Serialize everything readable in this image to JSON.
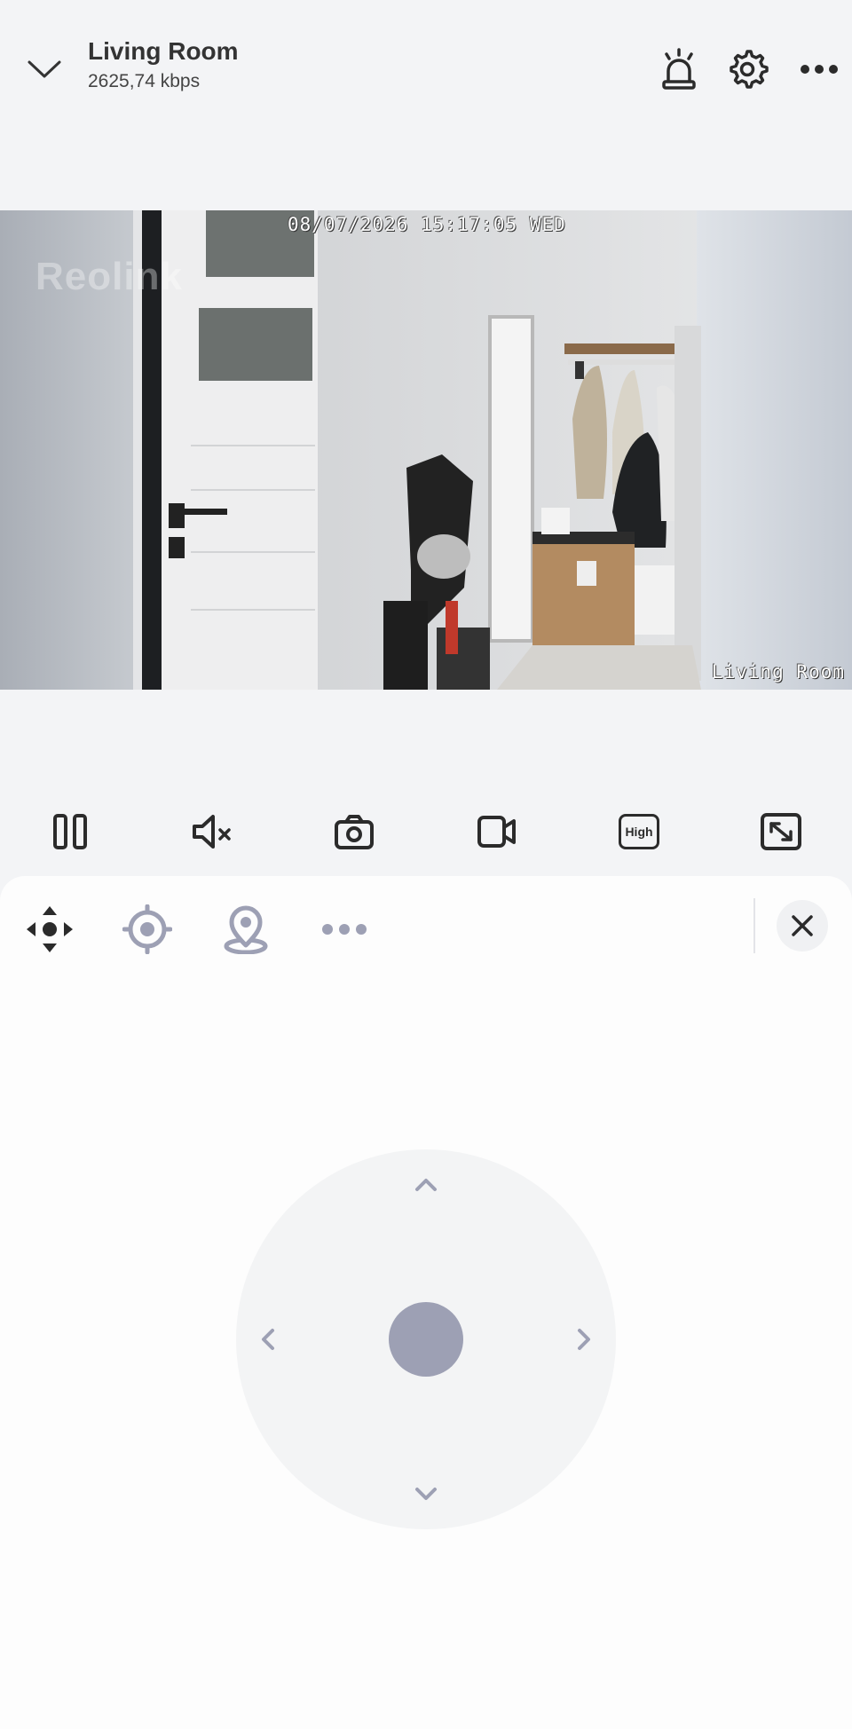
{
  "header": {
    "title": "Living Room",
    "bitrate": "2625,74 kbps"
  },
  "video": {
    "timestamp": "08/07/2026 15:17:05 WED",
    "channel_name": "Living Room",
    "watermark": "Reolink"
  },
  "controls": {
    "quality_label": "High"
  },
  "icons": {
    "back": "chevron-down-icon",
    "alarm": "siren-icon",
    "settings": "gear-icon",
    "more": "more-icon",
    "pause": "pause-icon",
    "mute": "mute-icon",
    "snapshot": "camera-icon",
    "record": "video-record-icon",
    "fullscreen": "fullscreen-icon",
    "ptz": "ptz-move-icon",
    "preset": "target-icon",
    "track": "location-pin-icon",
    "close": "close-icon"
  },
  "colors": {
    "icon_dark": "#2b2b2b",
    "icon_muted": "#9da0b4",
    "joystick_bg": "#f3f4f5"
  }
}
